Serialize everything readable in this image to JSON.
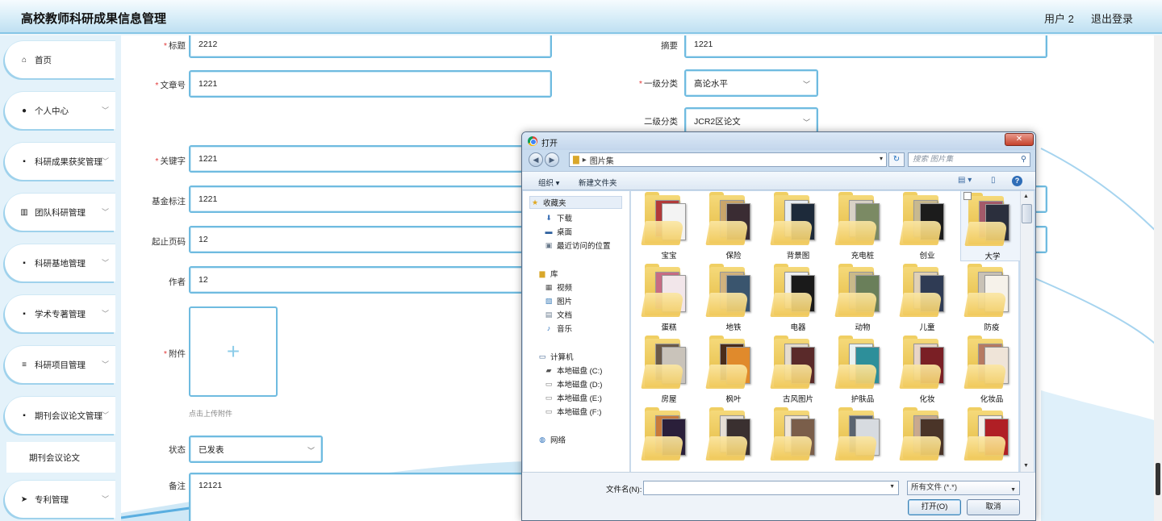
{
  "app": {
    "title": "高校教师科研成果信息管理",
    "user": "用户 2",
    "logout": "退出登录"
  },
  "sidebar": {
    "items": [
      {
        "label": "首页",
        "icon": "home-icon",
        "glyph": "⌂",
        "expandable": false
      },
      {
        "label": "个人中心",
        "icon": "user-icon",
        "glyph": "●",
        "expandable": true
      },
      {
        "label": "科研成果获奖管理",
        "icon": "grid-icon",
        "glyph": "▪",
        "expandable": true
      },
      {
        "label": "团队科研管理",
        "icon": "library-icon",
        "glyph": "▥",
        "expandable": true
      },
      {
        "label": "科研基地管理",
        "icon": "grid-icon",
        "glyph": "▪",
        "expandable": true
      },
      {
        "label": "学术专著管理",
        "icon": "grid-icon",
        "glyph": "▪",
        "expandable": true
      },
      {
        "label": "科研项目管理",
        "icon": "list-icon",
        "glyph": "≡",
        "expandable": true
      },
      {
        "label": "期刊会议论文管理",
        "icon": "grid-icon",
        "glyph": "▪",
        "expandable": true
      },
      {
        "label": "专利管理",
        "icon": "send-icon",
        "glyph": "➤",
        "expandable": true
      }
    ],
    "sub_item": "期刊会议论文"
  },
  "form": {
    "title": {
      "label": "标题",
      "value": "2212"
    },
    "abstract": {
      "label": "摘要",
      "value": "1221"
    },
    "article_no": {
      "label": "文章号",
      "value": "1221"
    },
    "category1": {
      "label": "一级分类",
      "value": "高论水平"
    },
    "category2": {
      "label": "二级分类",
      "value": "JCR2区论文"
    },
    "keywords": {
      "label": "关键字",
      "value": "1221"
    },
    "fund": {
      "label": "基金标注",
      "value": "1221"
    },
    "pages": {
      "label": "起止页码",
      "value": "12"
    },
    "author": {
      "label": "作者",
      "value": "12"
    },
    "attachment": {
      "label": "附件",
      "hint": "点击上传附件"
    },
    "status": {
      "label": "状态",
      "value": "已发表"
    },
    "remark": {
      "label": "备注",
      "value": "12121"
    }
  },
  "dialog": {
    "title": "打开",
    "path": "图片集",
    "search_placeholder": "搜索 图片集",
    "toolbar": {
      "organize": "组织 ▾",
      "new_folder": "新建文件夹"
    },
    "nav": {
      "favorites": "收藏夹",
      "downloads": "下载",
      "desktop": "桌面",
      "recent": "最近访问的位置",
      "libraries": "库",
      "videos": "视频",
      "pictures": "图片",
      "documents": "文档",
      "music": "音乐",
      "computer": "计算机",
      "disk_c": "本地磁盘 (C:)",
      "disk_d": "本地磁盘 (D:)",
      "disk_e": "本地磁盘 (E:)",
      "disk_f": "本地磁盘 (F:)",
      "network": "网络"
    },
    "folders": [
      "宝宝",
      "保险",
      "背景图",
      "充电桩",
      "创业",
      "大学",
      "蛋糕",
      "地铁",
      "电器",
      "动物",
      "儿童",
      "防疫",
      "房屋",
      "枫叶",
      "古风图片",
      "护肤品",
      "化妆",
      "化妆品",
      "",
      "",
      "",
      "",
      "",
      ""
    ],
    "filename_label": "文件名(N):",
    "filetype": "所有文件 (*.*)",
    "open_button": "打开(O)",
    "cancel_button": "取消"
  }
}
